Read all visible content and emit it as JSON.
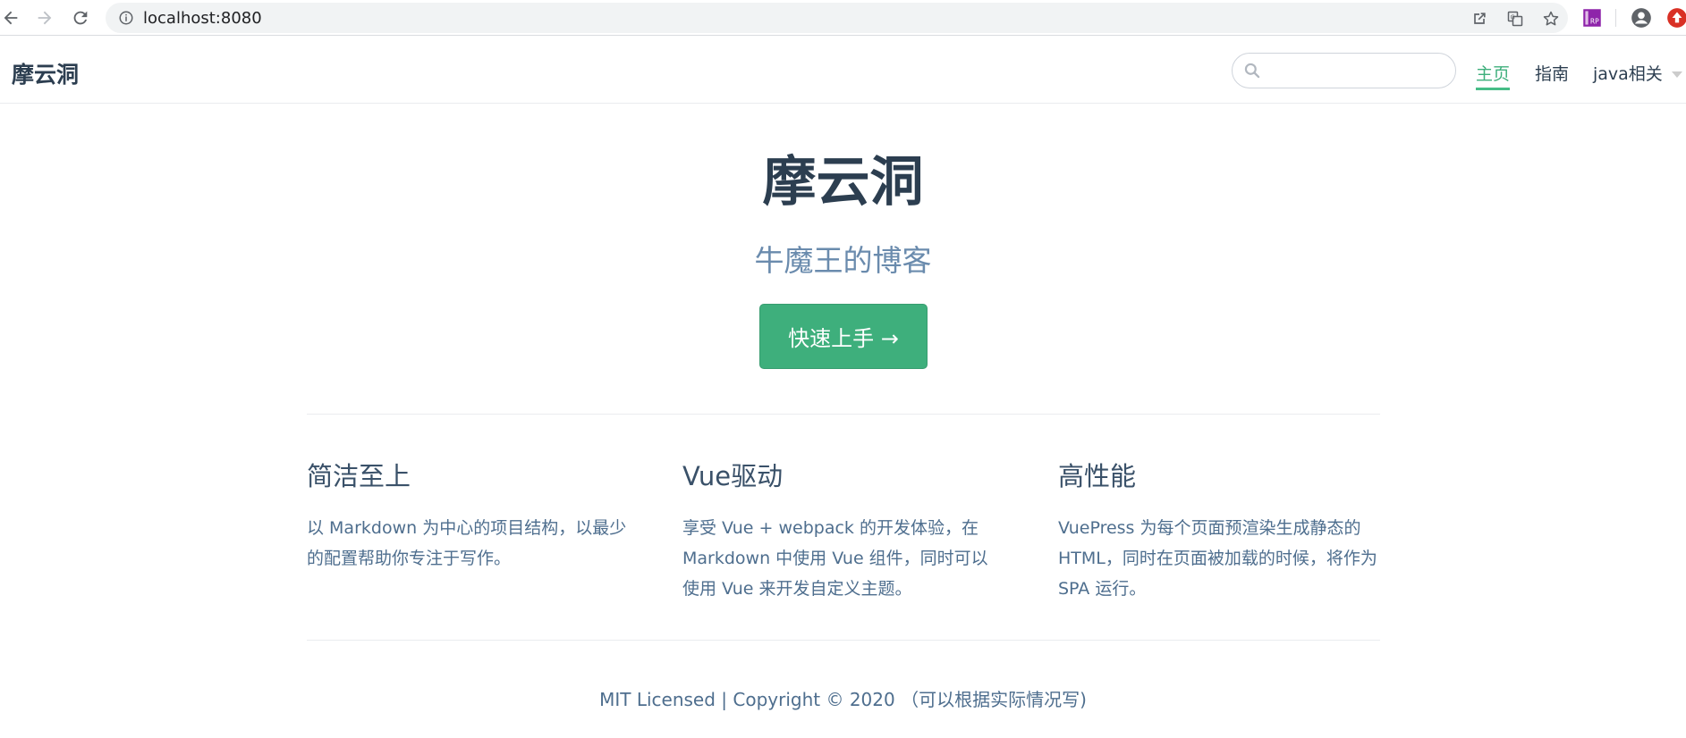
{
  "browser": {
    "url": "localhost:8080",
    "icons": [
      "back-icon",
      "forward-icon",
      "reload-icon",
      "info-icon",
      "open-in-app-icon",
      "translate-icon",
      "star-icon",
      "extension-rp-icon",
      "profile-icon",
      "extension-red-icon"
    ]
  },
  "site": {
    "name": "摩云洞",
    "nav": {
      "search_placeholder": "",
      "links": [
        {
          "label": "主页",
          "active": true
        },
        {
          "label": "指南",
          "active": false
        }
      ],
      "dropdown_label": "java相关"
    }
  },
  "hero": {
    "title": "摩云洞",
    "description": "牛魔王的博客",
    "action_label": "快速上手 →"
  },
  "features": [
    {
      "title": "简洁至上",
      "details": "以 Markdown 为中心的项目结构，以最少的配置帮助你专注于写作。"
    },
    {
      "title": "Vue驱动",
      "details": "享受 Vue + webpack 的开发体验，在 Markdown 中使用 Vue 组件，同时可以使用 Vue 来开发自定义主题。"
    },
    {
      "title": "高性能",
      "details": "VuePress 为每个页面预渲染生成静态的 HTML，同时在页面被加载的时候，将作为 SPA 运行。"
    }
  ],
  "footer": "MIT Licensed | Copyright © 2020 （可以根据实际情况写)",
  "colors": {
    "accent": "#3eaf7c",
    "text": "#2c3e50",
    "muted": "#6a8bad"
  }
}
